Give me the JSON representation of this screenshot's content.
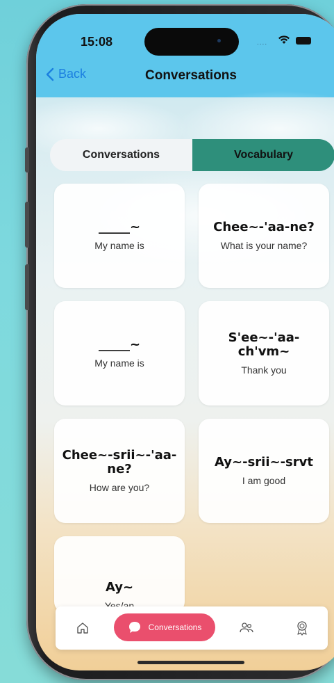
{
  "status_bar": {
    "time": "15:08",
    "signal": "....",
    "icons": [
      "wifi-icon",
      "battery-icon"
    ]
  },
  "navbar": {
    "back_label": "Back",
    "title": "Conversations"
  },
  "segmented": {
    "options": [
      {
        "label": "Conversations",
        "selected": false
      },
      {
        "label": "Vocabulary",
        "selected": true
      }
    ]
  },
  "cards": [
    {
      "word": "_____~",
      "meaning": "My name is"
    },
    {
      "word": "Chee~-'aa-ne?",
      "meaning": "What is your name?"
    },
    {
      "word": "_____~",
      "meaning": "My name is"
    },
    {
      "word": "S'ee~-'aa-ch'vm~",
      "meaning": "Thank you"
    },
    {
      "word": "Chee~-srii~-'aa-ne?",
      "meaning": "How are you?"
    },
    {
      "word": "Ay~-srii~-srvt",
      "meaning": "I am good"
    },
    {
      "word": "Ay~",
      "meaning": "Yes/an"
    }
  ],
  "tabbar": {
    "items": [
      {
        "icon": "home-icon",
        "label": ""
      },
      {
        "icon": "chat-bubble-icon",
        "label": "Conversations",
        "selected": true
      },
      {
        "icon": "people-icon",
        "label": ""
      },
      {
        "icon": "award-icon",
        "label": ""
      }
    ]
  },
  "colors": {
    "accent_teal": "#2e8f7b",
    "tab_pill": "#ea4f6d",
    "back_blue": "#1b7fe0",
    "header_sky": "#5cc6ec"
  }
}
